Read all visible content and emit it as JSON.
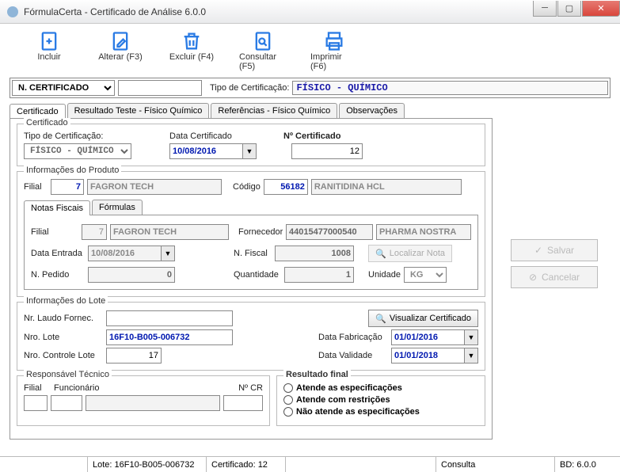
{
  "window": {
    "title": "FórmulaCerta - Certificado de Análise 6.0.0"
  },
  "toolbar": {
    "incluir": "Incluir",
    "alterar": "Alterar (F3)",
    "excluir": "Excluir (F4)",
    "consultar": "Consultar (F5)",
    "imprimir": "Imprimir (F6)"
  },
  "filter": {
    "field": "N. CERTIFICADO",
    "label_tipo": "Tipo de Certificação:",
    "tipo_value": "FÍSICO - QUÍMICO"
  },
  "main_tabs": {
    "t1": "Certificado",
    "t2": "Resultado Teste - Físico Químico",
    "t3": "Referências - Físico Químico",
    "t4": "Observações"
  },
  "side": {
    "salvar": "Salvar",
    "cancelar": "Cancelar"
  },
  "certificado": {
    "legend": "Certificado",
    "lbl_tipo": "Tipo de Certificação:",
    "tipo": "FÍSICO - QUÍMICO",
    "lbl_data": "Data Certificado",
    "data": "10/08/2016",
    "lbl_num": "Nº Certificado",
    "num": "12"
  },
  "produto": {
    "legend": "Informações do Produto",
    "lbl_filial": "Filial",
    "filial": "7",
    "filial_nome": "FAGRON TECH",
    "lbl_codigo": "Código",
    "codigo": "56182",
    "codigo_nome": "RANITIDINA HCL"
  },
  "subtabs": {
    "nf": "Notas Fiscais",
    "fm": "Fórmulas"
  },
  "nf": {
    "lbl_filial": "Filial",
    "filial": "7",
    "filial_nome": "FAGRON TECH",
    "lbl_forn": "Fornecedor",
    "forn": "44015477000540",
    "forn_nome": "PHARMA NOSTRA",
    "lbl_entrada": "Data Entrada",
    "entrada": "10/08/2016",
    "lbl_nfiscal": "N. Fiscal",
    "nfiscal": "1008",
    "btn_localizar": "Localizar Nota",
    "lbl_pedido": "N. Pedido",
    "pedido": "0",
    "lbl_qtd": "Quantidade",
    "qtd": "1",
    "lbl_un": "Unidade",
    "un": "KG"
  },
  "lote": {
    "legend": "Informações do Lote",
    "lbl_laudo": "Nr. Laudo Fornec.",
    "laudo": "",
    "btn_visualizar": "Visualizar Certificado",
    "lbl_nlote": "Nro. Lote",
    "nlote": "16F10-B005-006732",
    "lbl_fab": "Data Fabricação",
    "fab": "01/01/2016",
    "lbl_ctrl": "Nro. Controle Lote",
    "ctrl": "17",
    "lbl_val": "Data Validade",
    "val": "01/01/2018"
  },
  "resp": {
    "legend": "Responsável Técnico",
    "lbl_filial": "Filial",
    "lbl_func": "Funcionário",
    "lbl_cr": "Nº CR"
  },
  "resultado": {
    "legend": "Resultado final",
    "op1": "Atende as especificações",
    "op2": "Atende com restrições",
    "op3": "Não atende as especificações"
  },
  "status": {
    "lote": "Lote: 16F10-B005-006732",
    "cert": "Certificado: 12",
    "modo": "Consulta",
    "bd": "BD: 6.0.0"
  }
}
